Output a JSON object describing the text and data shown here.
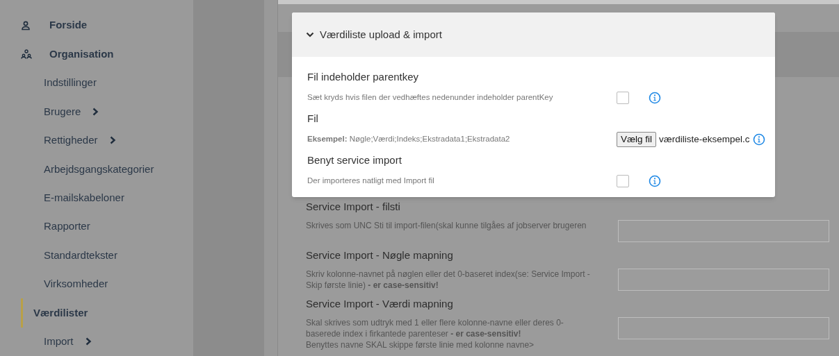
{
  "sidebar": {
    "items": [
      {
        "label": "Forside",
        "kind": "top",
        "selected": false,
        "has_children": false
      },
      {
        "label": "Organisation",
        "kind": "top",
        "selected": false,
        "has_children": false
      },
      {
        "label": "Indstillinger",
        "kind": "sub",
        "selected": false,
        "has_children": false
      },
      {
        "label": "Brugere",
        "kind": "sub",
        "selected": false,
        "has_children": true
      },
      {
        "label": "Rettigheder",
        "kind": "sub",
        "selected": false,
        "has_children": true
      },
      {
        "label": "Arbejdsgangskategorier",
        "kind": "sub",
        "selected": false,
        "has_children": false
      },
      {
        "label": "E-mailskabeloner",
        "kind": "sub",
        "selected": false,
        "has_children": false
      },
      {
        "label": "Rapporter",
        "kind": "sub",
        "selected": false,
        "has_children": false
      },
      {
        "label": "Standardtekster",
        "kind": "sub",
        "selected": false,
        "has_children": false
      },
      {
        "label": "Virksomheder",
        "kind": "sub",
        "selected": false,
        "has_children": false
      },
      {
        "label": "Værdilister",
        "kind": "sub",
        "selected": true,
        "has_children": false
      },
      {
        "label": "Import",
        "kind": "sub",
        "selected": false,
        "has_children": true
      }
    ]
  },
  "panel": {
    "title": "Værdiliste upload & import",
    "expanded": true,
    "fields": [
      {
        "kind": "checkbox",
        "label": "Fil indeholder parentkey",
        "description": "Sæt kryds hvis filen der vedhæftes nedenunder indeholder parentKey",
        "checked": false
      },
      {
        "kind": "file",
        "label": "Fil",
        "description": "**Eksempel:** Nøgle;Værdi;Indeks;Ekstradata1;Ekstradata2",
        "button": "Vælg fil",
        "filename": "værdiliste-eksempel.c"
      },
      {
        "kind": "checkbox",
        "label": "Benyt service import",
        "description": "Der importeres natligt med Import fil",
        "checked": false
      }
    ]
  },
  "background_fields": [
    {
      "kind": "text",
      "label": "Service Import - filsti",
      "description": "Skrives som UNC Sti til import-filen(skal kunne tilgåes af jobserver brugeren"
    },
    {
      "kind": "text",
      "label": "Service Import - Nøgle mapning",
      "description": "Skriv kolonne-navnet på nøglen eller det 0-baseret index(se: Service Import - Skip første linie) **- er case-sensitiv!**"
    },
    {
      "kind": "text",
      "label": "Service Import - Værdi mapning",
      "description": "Skal skrives som udtryk med 1 eller flere kolonne-navne eller deres 0-baserede index i firkantede parenteser **- er case-sensitiv!**",
      "note": "Benyttes navne SKAL skippe første linie med kolonne navne>"
    }
  ]
}
